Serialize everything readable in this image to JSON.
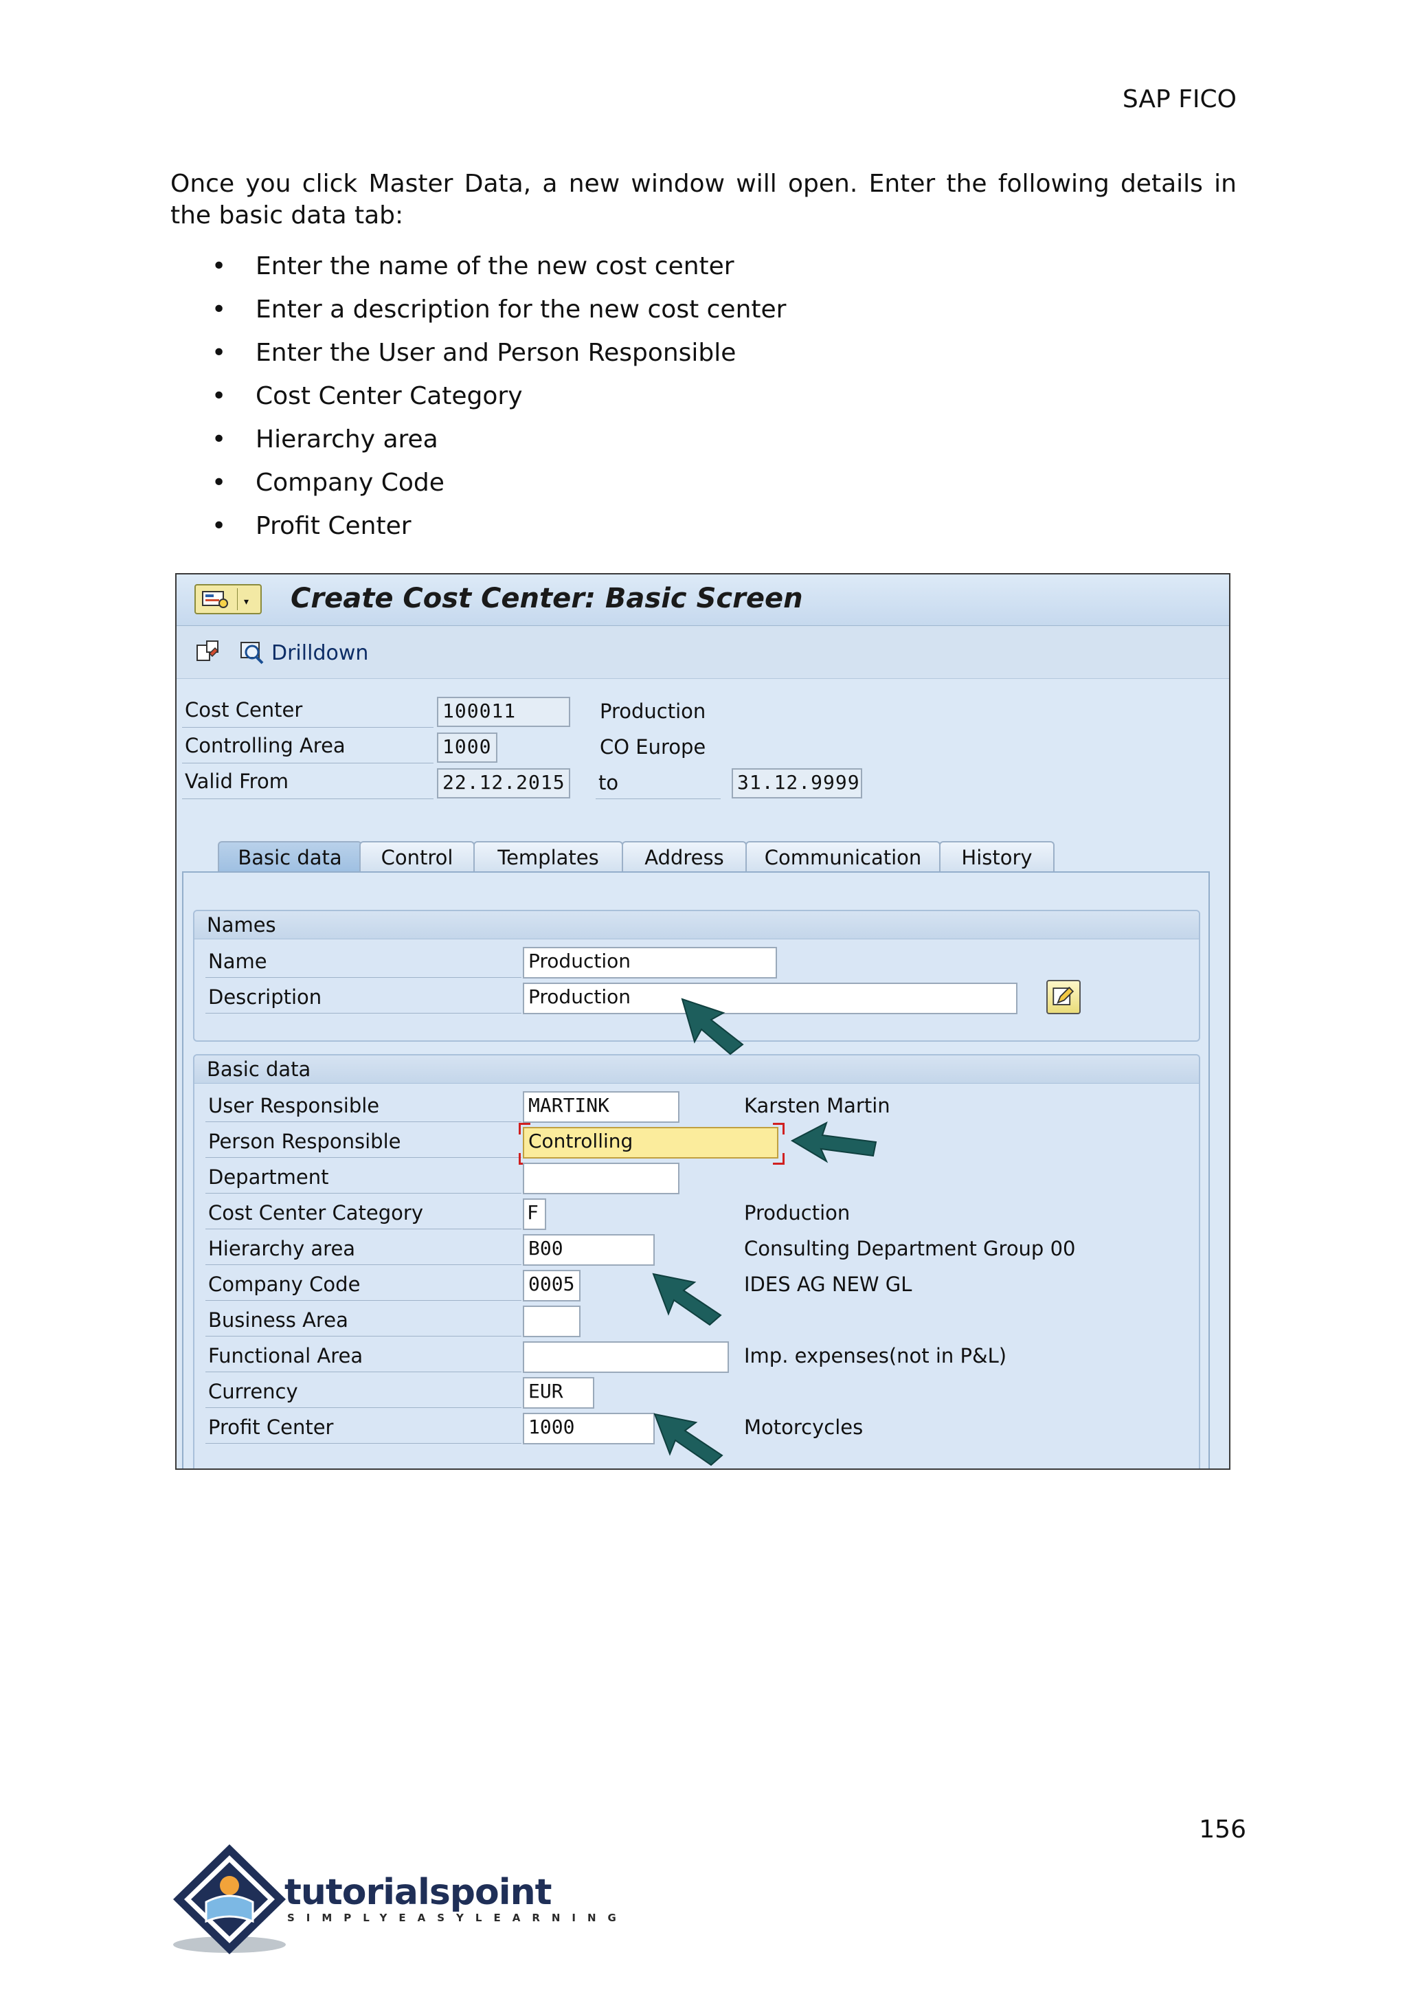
{
  "header": {
    "title": "SAP FICO"
  },
  "intro": "Once you click Master Data, a new window will open. Enter the following details in the basic data tab:",
  "bullets": [
    "Enter the name of the new cost center",
    "Enter a description for the new cost center",
    "Enter the User and Person Responsible",
    "Cost Center Category",
    "Hierarchy area",
    "Company Code",
    "Profit Center"
  ],
  "sap": {
    "title": "Create Cost Center: Basic Screen",
    "toolbar": {
      "drilldown": "Drilldown"
    },
    "header_fields": {
      "cost_center": {
        "label": "Cost Center",
        "value": "100011",
        "text": "Production"
      },
      "controlling_area": {
        "label": "Controlling Area",
        "value": "1000",
        "text": "CO Europe"
      },
      "valid_from": {
        "label": "Valid From",
        "value": "22.12.2015",
        "to_label": "to",
        "to_value": "31.12.9999"
      }
    },
    "tabs": [
      "Basic data",
      "Control",
      "Templates",
      "Address",
      "Communication",
      "History"
    ],
    "names_group": {
      "title": "Names",
      "name": {
        "label": "Name",
        "value": "Production"
      },
      "description": {
        "label": "Description",
        "value": "Production"
      }
    },
    "basic_group": {
      "title": "Basic data",
      "user_responsible": {
        "label": "User Responsible",
        "value": "MARTINK",
        "text": "Karsten Martin"
      },
      "person_responsible": {
        "label": "Person Responsible",
        "value": "Controlling"
      },
      "department": {
        "label": "Department",
        "value": ""
      },
      "category": {
        "label": "Cost Center Category",
        "value": "F",
        "text": "Production"
      },
      "hierarchy": {
        "label": "Hierarchy area",
        "value": "B00",
        "text": "Consulting Department Group 00"
      },
      "company_code": {
        "label": "Company Code",
        "value": "0005",
        "text": "IDES AG NEW GL"
      },
      "business_area": {
        "label": "Business Area",
        "value": ""
      },
      "functional_area": {
        "label": "Functional Area",
        "value": "",
        "text": "Imp. expenses(not in P&L)"
      },
      "currency": {
        "label": "Currency",
        "value": "EUR"
      },
      "profit_center": {
        "label": "Profit Center",
        "value": "1000",
        "text": "Motorcycles"
      }
    }
  },
  "footer": {
    "page_number": "156",
    "logo_text": "tutorialspoint",
    "logo_tagline": "SIMPLYEASYLEARNING"
  },
  "colors": {
    "arrow": "#1d5e5c",
    "highlight_field": "#fbec9c",
    "panel_bg": "#dbe8f6"
  },
  "icons": [
    "menu-icon",
    "display-change-icon",
    "drilldown-icon",
    "edit-text-icon",
    "arrow-pointer-icon"
  ]
}
